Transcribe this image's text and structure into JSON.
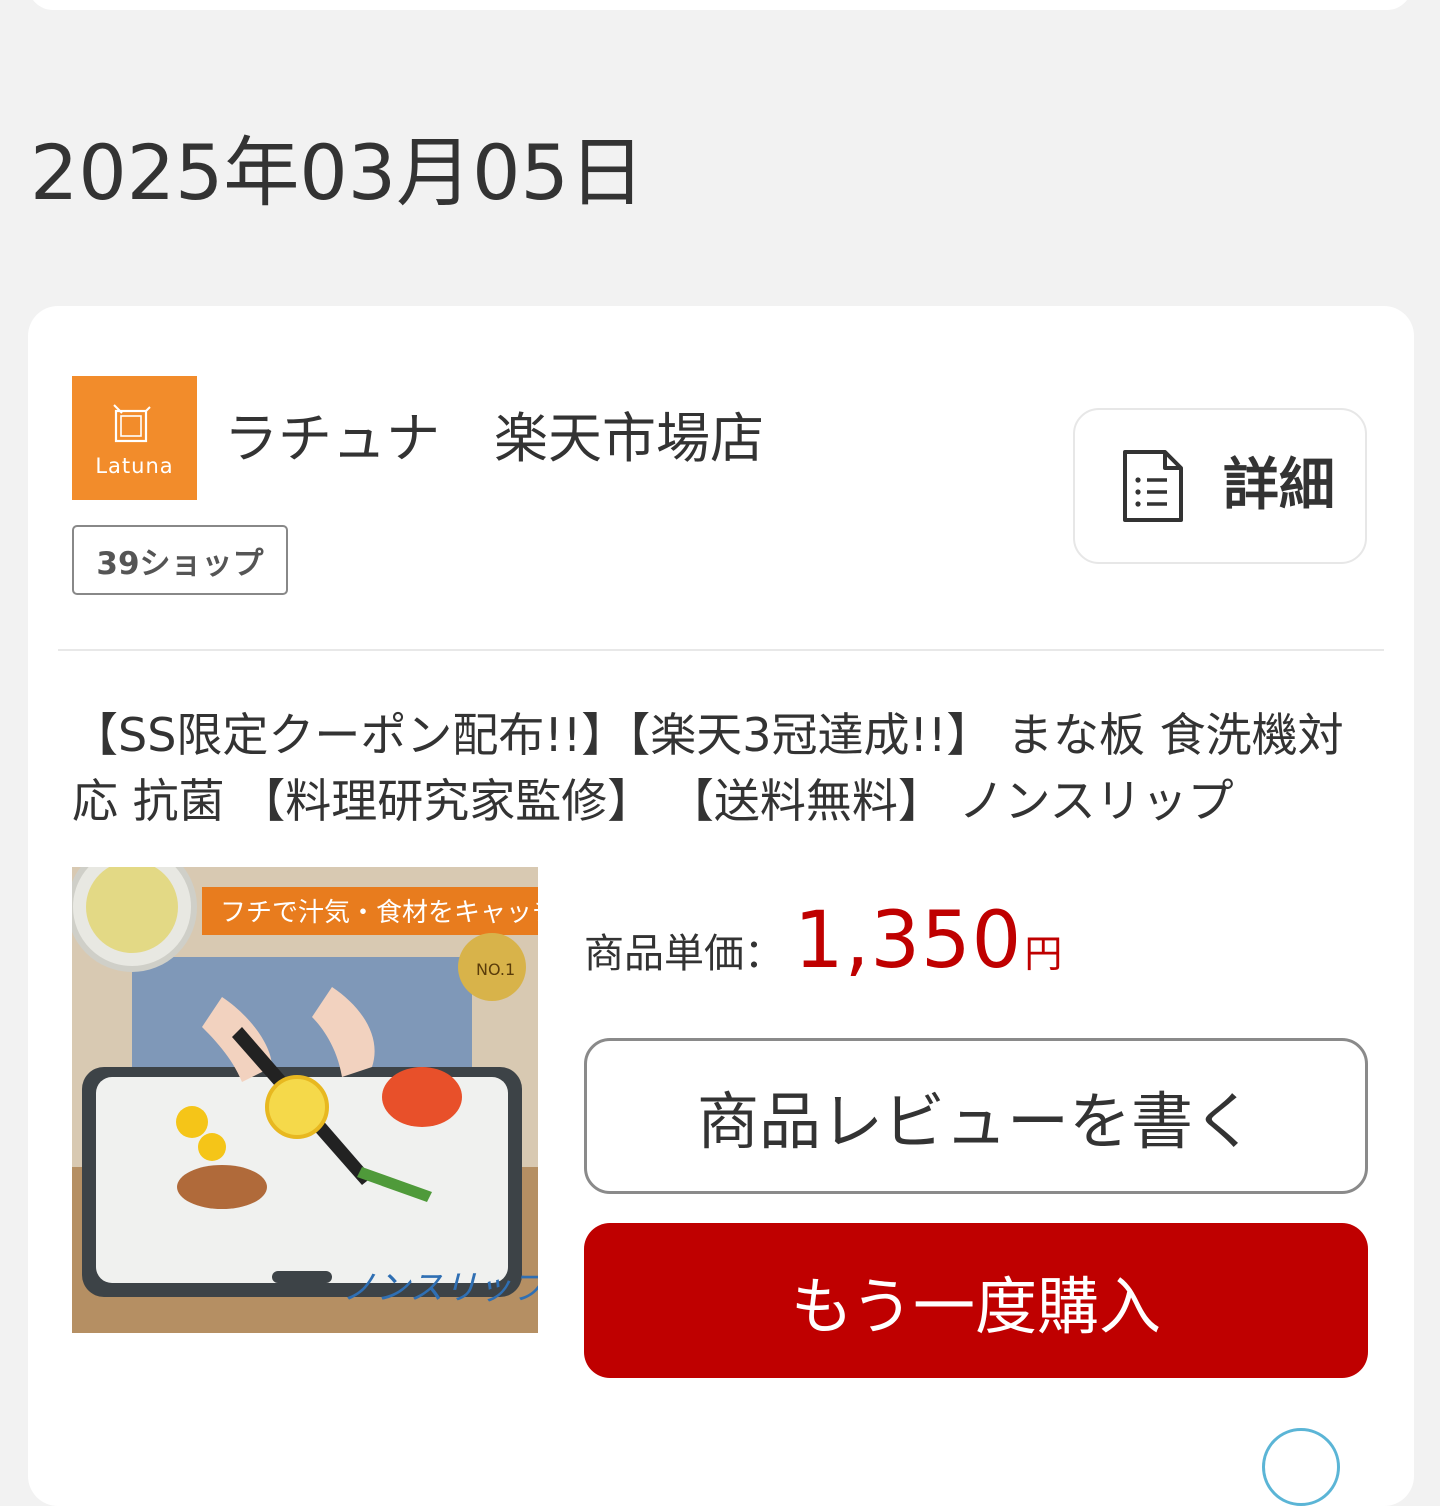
{
  "order": {
    "date": "2025年03月05日"
  },
  "shop": {
    "name": "ラチュナ　楽天市場店",
    "logo_text": "Latuna",
    "badge": "39ショップ",
    "detail_label": "詳細"
  },
  "product": {
    "title": "【SS限定クーポン配布!!】【楽天3冠達成!!】 まな板 食洗機対応 抗菌 【料理研究家監修】 【送料無料】 ノンスリップ",
    "image_caption_top": "フチで汁気・食材をキャッチ",
    "image_caption_bottom": "ノンスリップ",
    "image_badge": "NO.1",
    "price_label": "商品単価：",
    "price_value": "1,350",
    "price_unit": "円"
  },
  "actions": {
    "review_label": "商品レビューを書く",
    "rebuy_label": "もう一度購入"
  },
  "colors": {
    "accent_red": "#bf0000",
    "logo_orange": "#f28c2b",
    "background": "#f2f2f2",
    "card": "#ffffff"
  },
  "icons": {
    "detail": "document-list-icon",
    "logo_mark": "square-frame-icon"
  }
}
